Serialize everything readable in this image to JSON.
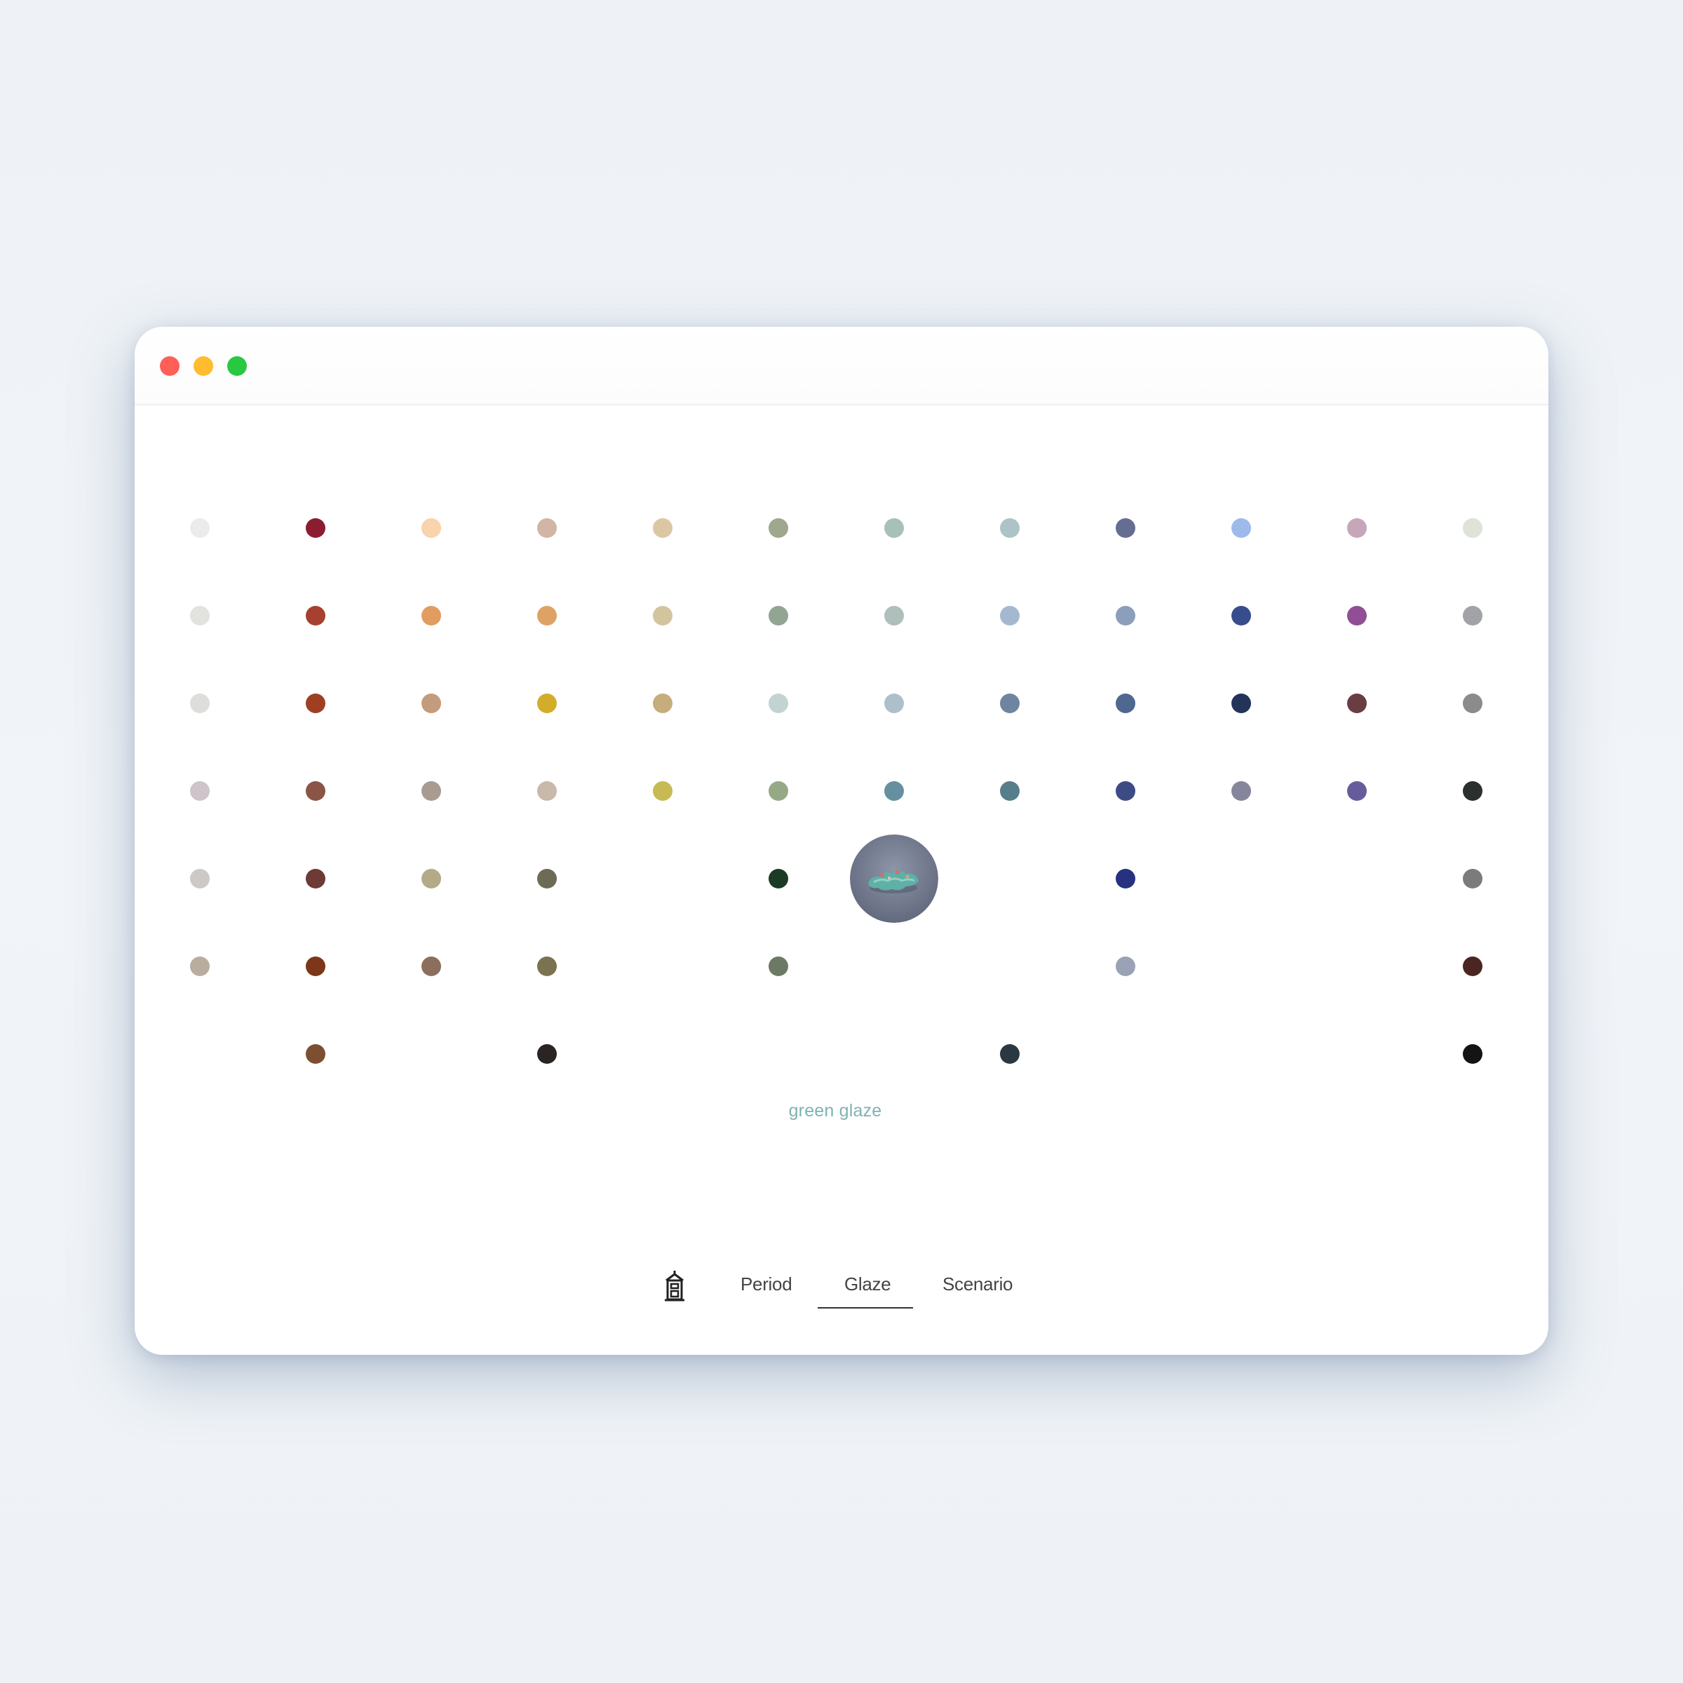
{
  "window": {
    "traffic_lights": [
      {
        "name": "close",
        "color": "#fe5f57"
      },
      {
        "name": "minimize",
        "color": "#febc2e"
      },
      {
        "name": "zoom",
        "color": "#28c840"
      }
    ]
  },
  "glaze_grid": {
    "rows": [
      [
        "#ebebeb",
        "#8c1c2f",
        "#f8d3ac",
        "#d2b5a4",
        "#dcc7a4",
        "#9fa78c",
        "#a7c1b8",
        "#acc3c7",
        "#656e92",
        "#9dbaeb",
        "#c6a6b8",
        "#dde3d6"
      ],
      [
        "#e2e2df",
        "#a6412f",
        "#e29b60",
        "#dea264",
        "#d2c59e",
        "#92a492",
        "#afbfbb",
        "#a4b9d0",
        "#8b9ebb",
        "#384e8c",
        "#8f4e95",
        "#a2a3a6"
      ],
      [
        "#dddddb",
        "#9e3f23",
        "#c49b7d",
        "#d1ad2a",
        "#c6ad7c",
        "#c3d3d1",
        "#aebfcc",
        "#6f849f",
        "#4f6892",
        "#24335a",
        "#6a3d42",
        "#8b8b8b"
      ],
      [
        "#cfc4c9",
        "#8b5546",
        "#a89c91",
        "#c8b9aa",
        "#c7b954",
        "#96a987",
        "#66909f",
        "#577e8b",
        "#3d4b85",
        "#85869c",
        "#675c9b",
        "#2b2f2e"
      ],
      [
        "#cdc9c6",
        "#6d3a35",
        "#b3aa87",
        "#6d6a56",
        null,
        "#1c3b27",
        "SELECTED",
        null,
        "#26317f",
        null,
        null,
        "#7c7a7b"
      ],
      [
        "#b8ad9f",
        "#7c3718",
        "#8c6e5d",
        "#7b7350",
        null,
        "#6b7965",
        null,
        null,
        "#9aa2b5",
        null,
        null,
        "#4a2521"
      ],
      [
        null,
        "#7d4f32",
        null,
        "#2a2522",
        null,
        null,
        null,
        "#2a3941",
        null,
        null,
        null,
        "#141414"
      ]
    ],
    "selected": {
      "name": "green glaze",
      "caption_color": "#7fb3b0"
    }
  },
  "nav": {
    "icon": "pagoda-icon",
    "tabs": [
      {
        "label": "Period",
        "active": false
      },
      {
        "label": "Glaze",
        "active": true
      },
      {
        "label": "Scenario",
        "active": false
      }
    ]
  }
}
